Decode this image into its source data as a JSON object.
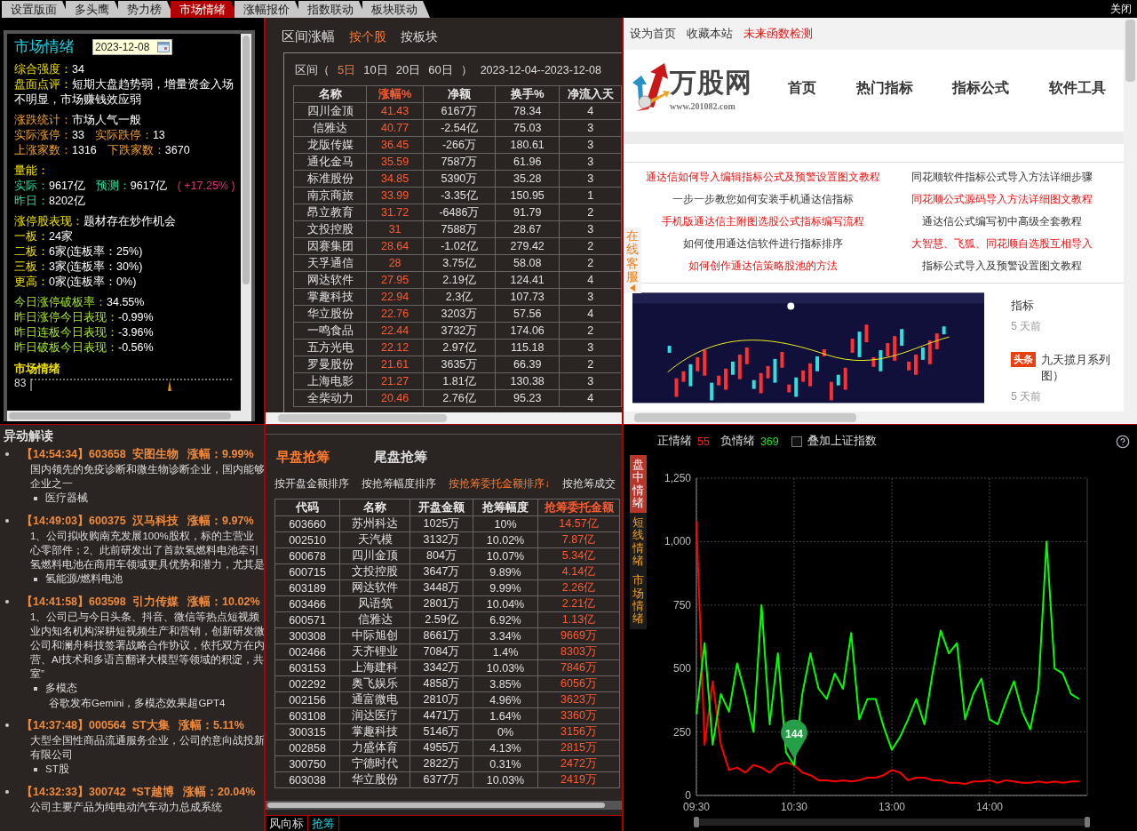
{
  "tabs": [
    {
      "label": "设置版面",
      "selected": false
    },
    {
      "label": "多头鹰",
      "selected": false
    },
    {
      "label": "势力榜",
      "selected": false
    },
    {
      "label": "市场情绪",
      "selected": true
    },
    {
      "label": "涨幅报价",
      "selected": false
    },
    {
      "label": "指数联动",
      "selected": false
    },
    {
      "label": "板块联动",
      "selected": false
    }
  ],
  "close": "关闭",
  "sentiment_panel": {
    "title": "市场情绪",
    "date": "2023-12-08",
    "groups": [
      [
        {
          "kind": "strength",
          "parts": [
            {
              "label": "综合强度：",
              "value": "34"
            }
          ]
        },
        {
          "kind": "strength",
          "parts": [
            {
              "label": "盘面点评：",
              "value": "短期大盘趋势弱，增量资金入场不明显，市场赚钱效应弱"
            }
          ]
        }
      ],
      [
        {
          "kind": "stat",
          "parts": [
            {
              "label": "涨跌统计：",
              "value": "市场人气一般"
            }
          ]
        },
        {
          "kind": "stat",
          "parts": [
            {
              "label": "实际涨停：",
              "value": "33"
            },
            {
              "label": "实际跌停：",
              "value": "13"
            }
          ]
        },
        {
          "kind": "stat",
          "parts": [
            {
              "label": "上涨家数：",
              "value": "1316"
            },
            {
              "label": "下跌家数：",
              "value": "3670"
            }
          ]
        }
      ],
      [
        {
          "kind": "strength",
          "parts": [
            {
              "label": "量能："
            }
          ]
        },
        {
          "kind": "energy",
          "parts": [
            {
              "label": "实际：",
              "value": "9617亿"
            },
            {
              "label": "预测：",
              "value": "9617亿",
              "note": "( +17.25% )"
            }
          ]
        },
        {
          "kind": "energy",
          "parts": [
            {
              "label": "昨日：",
              "value": "8202亿"
            }
          ]
        }
      ],
      [
        {
          "kind": "strength",
          "parts": [
            {
              "label": "涨停股表现：",
              "value": "题材存在炒作机会"
            }
          ]
        },
        {
          "kind": "strength",
          "parts": [
            {
              "label": "一板：",
              "value": "24家"
            }
          ]
        },
        {
          "kind": "strength",
          "parts": [
            {
              "label": "二板：",
              "value": "6家(连板率：25%)"
            }
          ]
        },
        {
          "kind": "strength",
          "parts": [
            {
              "label": "三板：",
              "value": "3家(连板率：30%)"
            }
          ]
        },
        {
          "kind": "strength",
          "parts": [
            {
              "label": "更高：",
              "value": "0家(连板率：0%)"
            }
          ]
        }
      ],
      [
        {
          "kind": "board",
          "parts": [
            {
              "label": "今日涨停破板率：",
              "value": "34.55%"
            }
          ]
        },
        {
          "kind": "board",
          "parts": [
            {
              "label": "昨日涨停今日表现：",
              "value": "-0.99%"
            }
          ]
        },
        {
          "kind": "board",
          "parts": [
            {
              "label": "昨日连板今日表现：",
              "value": "-3.96%"
            }
          ]
        },
        {
          "kind": "board",
          "parts": [
            {
              "label": "昨日破板今日表现：",
              "value": "-0.56%"
            }
          ]
        }
      ]
    ],
    "mood_chart": {
      "title": "市场情绪",
      "top_label": "83"
    }
  },
  "range_panel": {
    "title": "区间涨幅",
    "modes": [
      {
        "label": "按个股",
        "selected": true
      },
      {
        "label": "按板块",
        "selected": false
      }
    ],
    "period_open": "区间（",
    "periods": [
      {
        "label": "5日",
        "selected": true
      },
      {
        "label": "10日",
        "selected": false
      },
      {
        "label": "20日",
        "selected": false
      },
      {
        "label": "60日",
        "selected": false
      }
    ],
    "period_close": "）",
    "date_range": "2023-12-04--2023-12-08",
    "columns": [
      {
        "label": "名称",
        "sorted": false
      },
      {
        "label": "涨幅%",
        "sorted": true
      },
      {
        "label": "净额",
        "sorted": false
      },
      {
        "label": "换手%",
        "sorted": false
      },
      {
        "label": "净流入天",
        "sorted": false
      }
    ],
    "rows": [
      [
        "四川金顶",
        "41.43",
        "6167万",
        "78.34",
        "4"
      ],
      [
        "信雅达",
        "40.77",
        "-2.54亿",
        "75.03",
        "3"
      ],
      [
        "龙版传媒",
        "36.45",
        "-266万",
        "180.61",
        "3"
      ],
      [
        "通化金马",
        "35.59",
        "7587万",
        "61.96",
        "3"
      ],
      [
        "标准股份",
        "34.85",
        "5390万",
        "35.28",
        "3"
      ],
      [
        "南京商旅",
        "33.99",
        "-3.35亿",
        "150.95",
        "1"
      ],
      [
        "昂立教育",
        "31.72",
        "-6486万",
        "91.79",
        "2"
      ],
      [
        "文投控股",
        "31",
        "7588万",
        "28.67",
        "3"
      ],
      [
        "因赛集团",
        "28.64",
        "-1.02亿",
        "279.42",
        "2"
      ],
      [
        "天孚通信",
        "28",
        "3.75亿",
        "58.08",
        "2"
      ],
      [
        "网达软件",
        "27.95",
        "2.19亿",
        "124.41",
        "4"
      ],
      [
        "掌趣科技",
        "22.94",
        "2.3亿",
        "107.73",
        "3"
      ],
      [
        "华立股份",
        "22.76",
        "3203万",
        "57.56",
        "4"
      ],
      [
        "一鸣食品",
        "22.44",
        "3732万",
        "174.06",
        "2"
      ],
      [
        "五方光电",
        "22.12",
        "2.97亿",
        "115.18",
        "3"
      ],
      [
        "罗曼股份",
        "21.61",
        "3635万",
        "66.39",
        "2"
      ],
      [
        "上海电影",
        "21.27",
        "1.81亿",
        "130.38",
        "3"
      ],
      [
        "全柴动力",
        "20.46",
        "2.76亿",
        "95.23",
        "4"
      ]
    ]
  },
  "web_page": {
    "top_links": [
      {
        "label": "设为首页",
        "highlight": false
      },
      {
        "label": "收藏本站",
        "highlight": false
      },
      {
        "label": "未来函数检测",
        "highlight": true
      }
    ],
    "logo": {
      "name": "万股网",
      "url": "www.201082.com"
    },
    "nav": [
      "首页",
      "热门指标",
      "指标公式",
      "软件工具"
    ],
    "articles": [
      {
        "title": "通达信如何导入编辑指标公式及预警设置图文教程",
        "highlight": true
      },
      {
        "title": "同花顺软件指标公式导入方法详细步骤",
        "highlight": false
      },
      {
        "title": "一步一步教您如何安装手机通达信指标",
        "highlight": false
      },
      {
        "title": "同花顺公式源码导入方法详细图文教程",
        "highlight": true
      },
      {
        "title": "手机版通达信主附图选股公式指标编写流程",
        "highlight": true
      },
      {
        "title": "通达信公式编写初中高级全套教程",
        "highlight": false
      },
      {
        "title": "如何使用通达信软件进行指标排序",
        "highlight": false
      },
      {
        "title": "大智慧、飞狐、同花顺自选股互相导入",
        "highlight": true
      },
      {
        "title": "如何创作通达信策略股池的方法",
        "highlight": true
      },
      {
        "title": "指标公式导入及预警设置图文教程",
        "highlight": false
      }
    ],
    "side_tab": "在线客服",
    "feed": [
      {
        "title": "指标",
        "time": "5 天前"
      },
      {
        "badge": "头条",
        "title": "九天揽月系列图）",
        "time": "5 天前"
      }
    ]
  },
  "alerts_panel": {
    "title": "异动解读",
    "items": [
      {
        "header": "【14:54:34】603658  安图生物   涨幅：9.99%",
        "lines": [
          "国内领先的免疫诊断和微生物诊断企业，国内能够",
          "企业之一"
        ],
        "tags": [
          {
            "label": "医疗器械"
          }
        ]
      },
      {
        "header": "【14:49:03】600375  汉马科技   涨幅：9.97%",
        "lines": [
          "1、公司拟收购南充发展100%股权，标的主营业",
          "心零部件；2、此前研发出了首款氢燃料电池牵引",
          "氢燃料电池在商用车领域更具优势和潜力，尤其是"
        ],
        "tags": [
          {
            "label": "氢能源/燃料电池"
          }
        ]
      },
      {
        "header": "【14:41:58】603598  引力传媒   涨幅：10.02%",
        "lines": [
          "1、公司已与今日头条、抖音、微信等热点短视频",
          "业内知名机构深耕短视频生产和营销，创新研发微",
          "公司和澜舟科技签署战略合作协议，依托双方在内",
          "营、AI技术和多语言翻译大模型等领域的积淀，共",
          "室”"
        ],
        "tags": [
          {
            "label": "多模态",
            "note": "谷歌发布Gemini，多模态效果超GPT4"
          }
        ]
      },
      {
        "header": "【14:37:48】000564  ST大集   涨幅：5.11%",
        "lines": [
          "大型全国性商品流通服务企业，公司的意向战投新",
          "有限公司"
        ],
        "tags": [
          {
            "label": "ST股"
          }
        ]
      },
      {
        "header": "【14:32:33】300742  *ST越博   涨幅：20.04%",
        "lines": [
          "公司主要产品为纯电动汽车动力总成系统"
        ]
      }
    ]
  },
  "grab_panel": {
    "sessions": [
      {
        "label": "早盘抢筹",
        "selected": true
      },
      {
        "label": "尾盘抢筹",
        "selected": false
      }
    ],
    "sorts": [
      {
        "label": "按开盘金额排序",
        "selected": false
      },
      {
        "label": "按抢筹幅度排序",
        "selected": false
      },
      {
        "label": "按抢筹委托金额排序↓",
        "selected": true
      },
      {
        "label": "按抢筹成交",
        "selected": false
      }
    ],
    "columns": [
      {
        "label": "代码",
        "sorted": false
      },
      {
        "label": "名称",
        "sorted": false
      },
      {
        "label": "开盘金额",
        "sorted": false
      },
      {
        "label": "抢筹幅度",
        "sorted": false
      },
      {
        "label": "抢筹委托金额",
        "sorted": true
      }
    ],
    "rows": [
      [
        "603660",
        "苏州科达",
        "1025万",
        "10%",
        "14.57亿"
      ],
      [
        "002510",
        "天汽模",
        "3132万",
        "10.02%",
        "7.87亿"
      ],
      [
        "600678",
        "四川金顶",
        "804万",
        "10.07%",
        "5.34亿"
      ],
      [
        "600715",
        "文投控股",
        "3647万",
        "9.89%",
        "4.14亿"
      ],
      [
        "603189",
        "网达软件",
        "3448万",
        "9.99%",
        "2.26亿"
      ],
      [
        "603466",
        "风语筑",
        "2801万",
        "10.04%",
        "2.21亿"
      ],
      [
        "600571",
        "信雅达",
        "2.59亿",
        "6.92%",
        "1.13亿"
      ],
      [
        "300308",
        "中际旭创",
        "8661万",
        "3.34%",
        "9669万"
      ],
      [
        "002466",
        "天齐锂业",
        "7084万",
        "1.4%",
        "8303万"
      ],
      [
        "603153",
        "上海建科",
        "3342万",
        "10.03%",
        "7846万"
      ],
      [
        "002292",
        "奥飞娱乐",
        "4858万",
        "3.85%",
        "6056万"
      ],
      [
        "002156",
        "通富微电",
        "2810万",
        "4.96%",
        "3623万"
      ],
      [
        "603108",
        "润达医疗",
        "4471万",
        "1.64%",
        "3360万"
      ],
      [
        "300315",
        "掌趣科技",
        "5146万",
        "0%",
        "3156万"
      ],
      [
        "002858",
        "力盛体育",
        "4955万",
        "4.13%",
        "2815万"
      ],
      [
        "300750",
        "宁德时代",
        "2822万",
        "0.31%",
        "2472万"
      ],
      [
        "603038",
        "华立股份",
        "6377万",
        "10.03%",
        "2419万"
      ]
    ],
    "bottom_tabs": [
      {
        "label": "风向标",
        "selected": false
      },
      {
        "label": "抢筹",
        "selected": true
      }
    ]
  },
  "emotion_panel": {
    "positive_value": "55",
    "negative_value": "369",
    "overlay": {
      "label": "叠加上证指数",
      "checked": false
    },
    "views": [
      {
        "label": "盘中情绪",
        "selected": true
      },
      {
        "label": "短线情绪",
        "selected": false
      },
      {
        "label": "市场情绪",
        "selected": false
      }
    ],
    "chart_data": {
      "type": "line",
      "categories": [
        "09:30",
        null,
        null,
        null,
        null,
        null,
        null,
        null,
        null,
        null,
        null,
        null,
        "10:30",
        null,
        null,
        null,
        null,
        null,
        null,
        null,
        null,
        null,
        null,
        null,
        "13:00",
        null,
        null,
        null,
        null,
        null,
        null,
        null,
        null,
        null,
        null,
        null,
        "14:00",
        null,
        null,
        null,
        null,
        null,
        null,
        null,
        null,
        null,
        null,
        null
      ],
      "series": [
        {
          "name": "正情绪",
          "color": "#ff0000",
          "values": [
            1080,
            200,
            450,
            200,
            100,
            110,
            90,
            120,
            110,
            90,
            120,
            130,
            120,
            90,
            80,
            60,
            60,
            55,
            60,
            55,
            60,
            70,
            70,
            80,
            100,
            90,
            60,
            70,
            70,
            60,
            60,
            50,
            50,
            45,
            55,
            55,
            60,
            50,
            60,
            55,
            50,
            50,
            55,
            50,
            55,
            50,
            55,
            55
          ]
        },
        {
          "name": "负情绪",
          "color": "#00ff00",
          "values": [
            320,
            600,
            200,
            400,
            330,
            520,
            400,
            250,
            750,
            280,
            560,
            170,
            120,
            400,
            560,
            420,
            380,
            480,
            420,
            640,
            300,
            380,
            380,
            270,
            180,
            230,
            300,
            380,
            280,
            480,
            650,
            560,
            600,
            300,
            400,
            460,
            300,
            280,
            370,
            450,
            330,
            260,
            420,
            1000,
            500,
            480,
            400,
            380
          ]
        }
      ],
      "ylim": [
        0,
        1250
      ],
      "yticks": [
        {
          "value": 0,
          "label": "0"
        },
        {
          "value": 250,
          "label": "250"
        },
        {
          "value": 500,
          "label": "500"
        },
        {
          "value": 750,
          "label": "750"
        },
        {
          "value": 1000,
          "label": "1,000"
        },
        {
          "value": 1250,
          "label": "1,250"
        }
      ],
      "grid": true,
      "annotations": [
        {
          "x": "10:30",
          "y": 144,
          "text": "144"
        }
      ]
    }
  }
}
